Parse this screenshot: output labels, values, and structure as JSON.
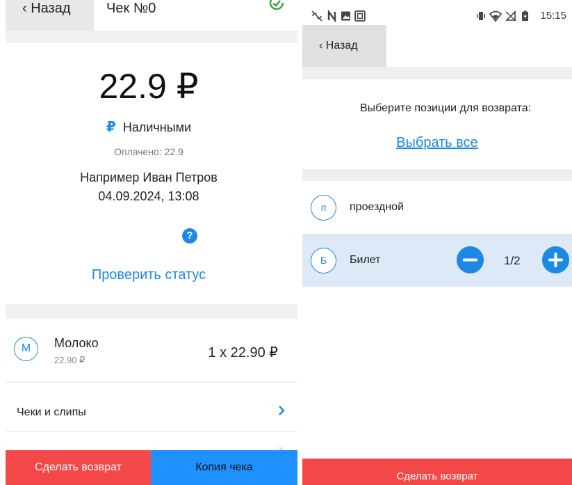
{
  "left": {
    "back_label": "‹ Назад",
    "title": "Чек №0",
    "amount": "22.9 ₽",
    "payment_symbol": "₽",
    "payment_method": "Наличными",
    "paid_label": "Оплачено:",
    "paid_value": "22.9",
    "cashier": "Например Иван Петров",
    "datetime": "04.09.2024, 13:08",
    "help_symbol": "?",
    "check_status_label": "Проверить статус",
    "item": {
      "avatar_letter": "М",
      "name": "Молоко",
      "unit_price": "22.90 ₽",
      "quantity_total": "1 x 22.90 ₽"
    },
    "receipts_label": "Чеки и слипы",
    "refund_button": "Сделать возврат",
    "copy_button": "Копия чека"
  },
  "right": {
    "status_bar": {
      "time": "15:15"
    },
    "back_label": "‹ Назад",
    "prompt": "Выберите позиции для возврата:",
    "select_all": "Выбрать все",
    "items": [
      {
        "avatar_letter": "п",
        "name": "проездной"
      },
      {
        "avatar_letter": "Б",
        "name": "Билет",
        "quantity": "1/2"
      }
    ],
    "refund_button": "Сделать возврат"
  },
  "colors": {
    "accent": "#1e88e5",
    "refund_red": "#f44848",
    "copy_blue": "#1e90ff",
    "selected_row": "#dde9f7",
    "band_gray": "#f1f1f1"
  }
}
